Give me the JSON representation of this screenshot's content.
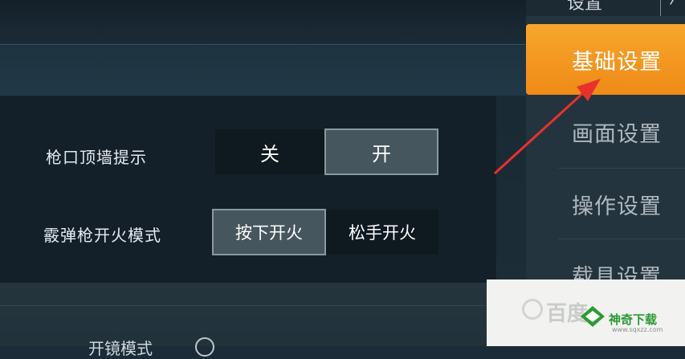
{
  "sidebar": {
    "header_label": "设置",
    "header_glyph": "⁄",
    "items": [
      {
        "label": "基础设置",
        "active": true
      },
      {
        "label": "画面设置",
        "active": false
      },
      {
        "label": "操作设置",
        "active": false
      },
      {
        "label": "载具设置",
        "active": false
      }
    ]
  },
  "settings": {
    "muzzle_hint": {
      "label": "枪口顶墙提示",
      "options": [
        "关",
        "开"
      ],
      "selected": "开"
    },
    "shotgun_fire_mode": {
      "label": "霰弹枪开火模式",
      "options": [
        "按下开火",
        "松手开火"
      ],
      "selected": "按下开火"
    },
    "scope_mode": {
      "label": "开镜模式"
    }
  },
  "watermark": {
    "left_text": "百度",
    "brand": "神奇下载",
    "url": "www.sqxzz.com",
    "brand_color": "#2d9a36"
  },
  "colors": {
    "accent": "#f39a22",
    "arrow": "#e8312b"
  }
}
